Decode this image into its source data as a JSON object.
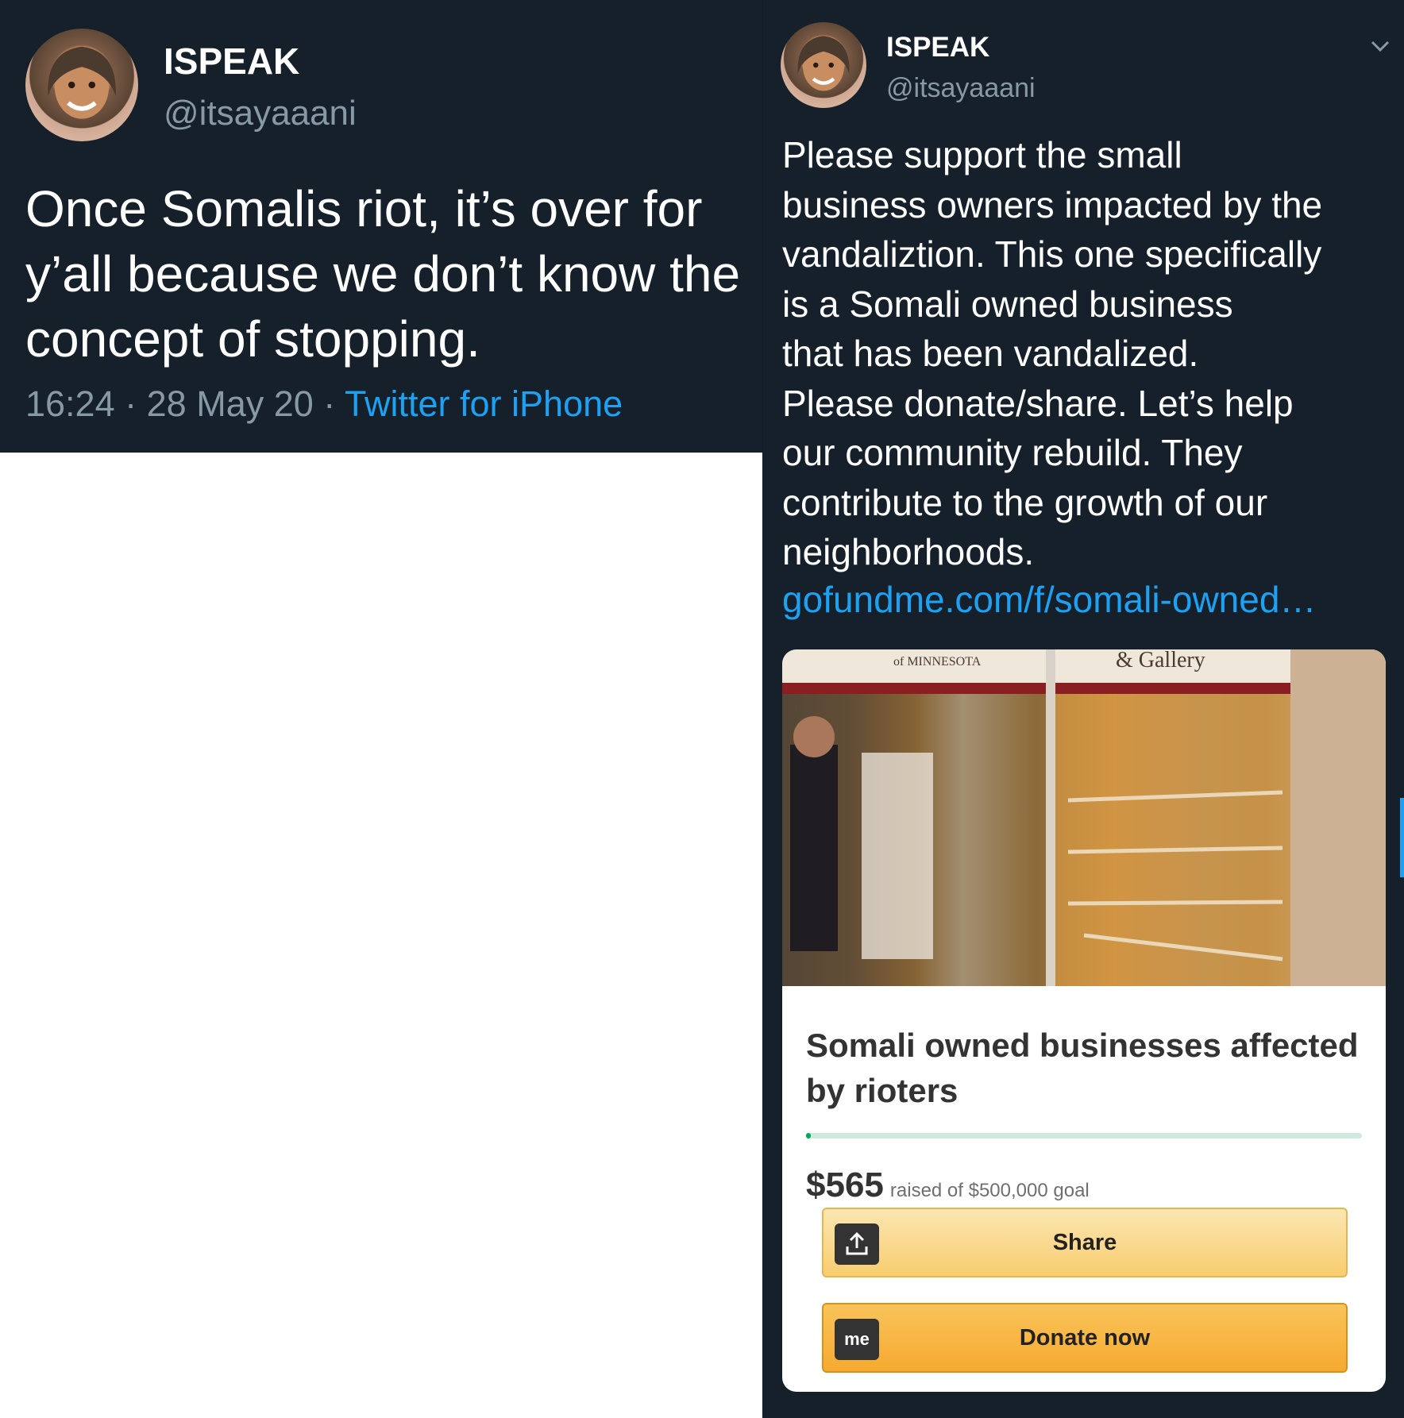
{
  "left_tweet": {
    "display_name": "ISPEAK",
    "handle": "@itsayaaani",
    "text_lines": [
      "Once Somalis riot, it’s over for",
      "y’all because we don’t know the",
      "concept of stopping."
    ],
    "time": "16:24",
    "date": "28 May 20",
    "separator": "·",
    "source": "Twitter for iPhone"
  },
  "right_tweet": {
    "display_name": "ISPEAK",
    "handle": "@itsayaaani",
    "menu_icon": "chevron-down-icon",
    "text_lines": [
      "Please support the small",
      "business owners impacted by the",
      "vandaliztion. This one specifically",
      "is a Somali owned business",
      "that has been vandalized.",
      "Please donate/share. Let’s help",
      "our community rebuild. They",
      "contribute to the growth of our",
      "neighborhoods."
    ],
    "link": "gofundme.com/f/somali-owned…",
    "card": {
      "photo_sign_left": "of MINNESOTA",
      "photo_sign_right": "& Gallery",
      "title_lines": [
        "Somali owned businesses affected",
        "by rioters"
      ],
      "raised_amount": "$565",
      "raised_text": "raised of $500,000 goal",
      "progress_fraction": 0.00113,
      "share_label": "Share",
      "share_icon": "share-upload-icon",
      "donate_label": "Donate now",
      "donate_icon": "gofundme-logo-icon",
      "donate_icon_text": "me"
    }
  },
  "colors": {
    "background": "#15202b",
    "link": "#1da1f2",
    "muted": "#8899a6",
    "progress": "#02a95c"
  }
}
